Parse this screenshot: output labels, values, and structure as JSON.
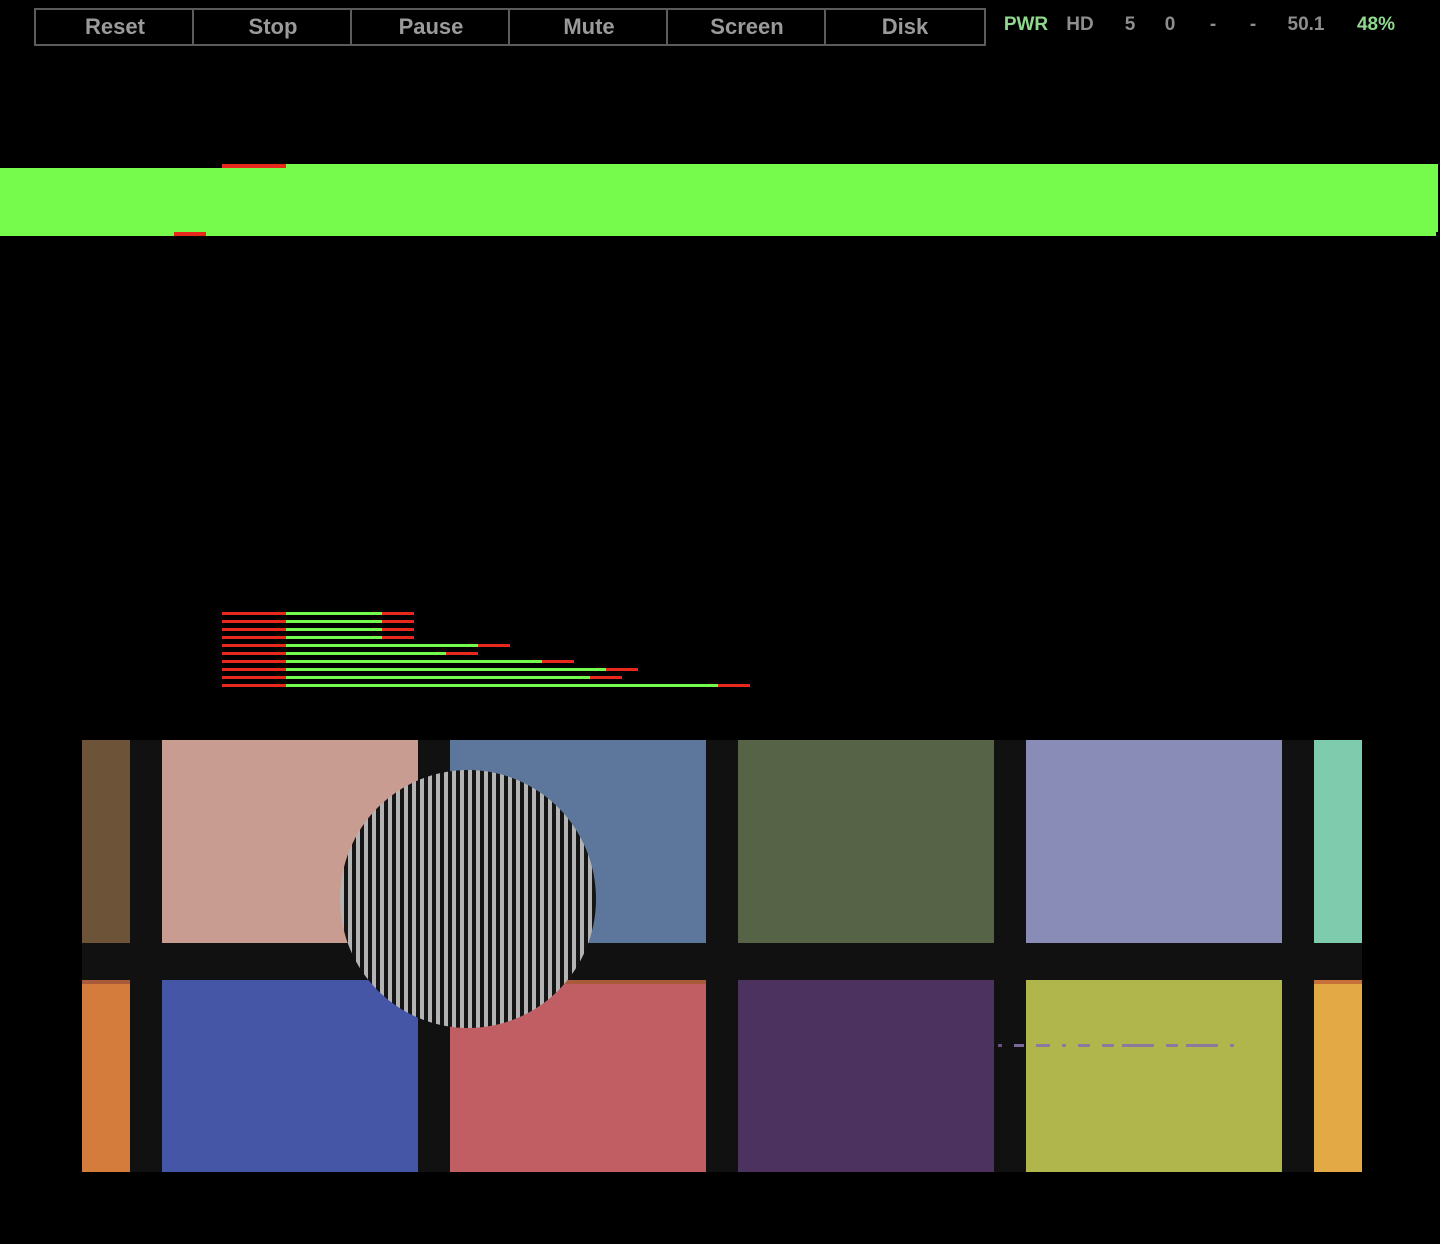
{
  "toolbar": {
    "buttons": [
      "Reset",
      "Stop",
      "Pause",
      "Mute",
      "Screen",
      "Disk"
    ],
    "status": {
      "power": "PWR",
      "hd": "HD",
      "value_a": "5",
      "value_b": "0",
      "value_c": "-",
      "value_d": "-",
      "speed": "50.1",
      "percent": "48%"
    }
  },
  "colors": {
    "background": "#000000",
    "stripe_green": "#76fa4b",
    "stripe_red": "#e8281c",
    "status_green": "#8fd98f",
    "status_grey": "#8e8e8e",
    "button_border": "#5c5c5c",
    "button_text": "#9a9a9a",
    "screen_frame": "#111111",
    "tiles": [
      "#6d5337",
      "#c89c91",
      "#5c779b",
      "#566346",
      "#8a8cb8",
      "#7ecbae",
      "#d47c3b",
      "#4456a5",
      "#c05e64",
      "#4c325e",
      "#b0b64c",
      "#e3a944"
    ],
    "disc_light": "#b4b4b4",
    "disc_dark": "#151515"
  },
  "icons": [
    "vertical-stripe-disc"
  ]
}
